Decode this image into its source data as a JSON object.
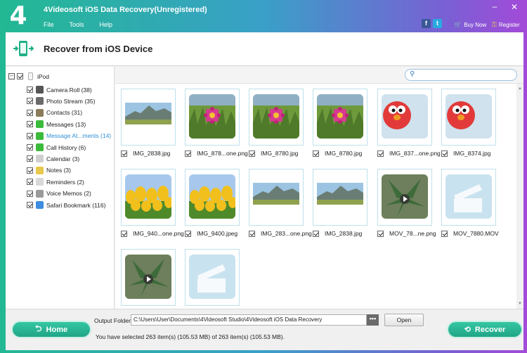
{
  "app": {
    "title": "4Videosoft iOS Data Recovery(Unregistered)",
    "logo": "4"
  },
  "menu": [
    "File",
    "Tools",
    "Help"
  ],
  "topbar": {
    "buy_now": "Buy Now",
    "register": "Register"
  },
  "header": {
    "title": "Recover from iOS Device"
  },
  "tree": {
    "root": "iPod",
    "items": [
      {
        "label": "Camera Roll (38)",
        "icon": "camera-icon",
        "color": "#555555"
      },
      {
        "label": "Photo Stream (35)",
        "icon": "photo-stream-icon",
        "color": "#6a6a6a"
      },
      {
        "label": "Contacts (31)",
        "icon": "contacts-icon",
        "color": "#8a7b5a"
      },
      {
        "label": "Messages (13)",
        "icon": "messages-icon",
        "color": "#3cba3c"
      },
      {
        "label": "Message At...ments (14)",
        "icon": "message-attachments-icon",
        "color": "#3cba3c"
      },
      {
        "label": "Call History (6)",
        "icon": "phone-icon",
        "color": "#3cba3c"
      },
      {
        "label": "Calendar (3)",
        "icon": "calendar-icon",
        "color": "#cfcfcf"
      },
      {
        "label": "Notes (3)",
        "icon": "notes-icon",
        "color": "#e8c84a"
      },
      {
        "label": "Reminders (2)",
        "icon": "reminders-icon",
        "color": "#d8d8d8"
      },
      {
        "label": "Voice Memos (2)",
        "icon": "voice-memo-icon",
        "color": "#9a9a9a"
      },
      {
        "label": "Safari Bookmark (116)",
        "icon": "safari-icon",
        "color": "#3b8de0"
      }
    ]
  },
  "files": [
    {
      "name": "IMG_2838.jpg",
      "thumb": "mountain"
    },
    {
      "name": "IMG_878...one.png",
      "thumb": "flower"
    },
    {
      "name": "IMG_8780.jpg",
      "thumb": "flower"
    },
    {
      "name": "IMG_8780.jpg",
      "thumb": "flower"
    },
    {
      "name": "IMG_837...one.png",
      "thumb": "elmo"
    },
    {
      "name": "IMG_8374.jpg",
      "thumb": "elmo"
    },
    {
      "name": "IMG_940...one.png",
      "thumb": "tulips"
    },
    {
      "name": "IMG_9400.jpeg",
      "thumb": "tulips"
    },
    {
      "name": "IMG_283...one.png",
      "thumb": "mountain"
    },
    {
      "name": "IMG_2838.jpg",
      "thumb": "mountain"
    },
    {
      "name": "MOV_78...ne.png",
      "thumb": "plant-video"
    },
    {
      "name": "MOV_7880.MOV",
      "thumb": "clapper"
    },
    {
      "name": "",
      "thumb": "plant-video"
    },
    {
      "name": "",
      "thumb": "clapper"
    }
  ],
  "bottom": {
    "home_label": "Home",
    "output_label": "Output Folder:",
    "output_path": "C:\\Users\\User\\Documents\\4Videosoft Studio\\4Videosoft iOS Data Recovery",
    "browse_label": "•••",
    "open_label": "Open",
    "status": "You have selected 263 item(s) (105.53 MB) of 263 item(s) (105.53 MB).",
    "recover_label": "Recover"
  },
  "colors": {
    "accent": "#22b893",
    "tile_border": "#bfe0ec"
  }
}
